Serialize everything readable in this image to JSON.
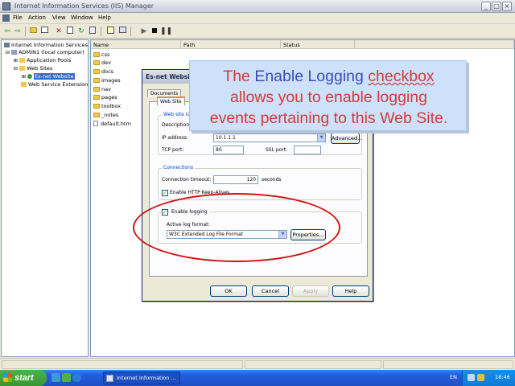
{
  "window": {
    "title": "Internet Information Services (IIS) Manager",
    "controls": {
      "minimize": "_",
      "maximize": "□",
      "close": "×"
    }
  },
  "menu": {
    "items": [
      "File",
      "Action",
      "View",
      "Window",
      "Help"
    ]
  },
  "toolbar": {
    "icons": [
      "back-arrow-icon",
      "forward-arrow-icon",
      "up-folder-icon",
      "show-tree-icon",
      "delete-icon",
      "properties-icon",
      "refresh-icon",
      "export-icon",
      "help-icon",
      "console-icon",
      "play-icon",
      "stop-icon",
      "pause-icon"
    ]
  },
  "tree": {
    "root": "Internet Information Services",
    "computer": "ADMIN1 (local computer)",
    "app_pools": "Application Pools",
    "web_sites": "Web Sites",
    "selected_site": "Es-net Website",
    "web_service_ext": "Web Service Extension"
  },
  "list": {
    "columns": [
      "Name",
      "Path",
      "Status"
    ],
    "folders": [
      "css",
      "dev",
      "docs",
      "images",
      "nav",
      "pages",
      "toolbox",
      "_notes"
    ],
    "files": [
      "default.htm"
    ]
  },
  "dialog": {
    "title": "Es-net Website Properties",
    "tabs": {
      "documents": "Documents",
      "web_site": "Web Site"
    },
    "identification": {
      "legend": "Web site identification",
      "description_label": "Description:",
      "ip_label": "IP address:",
      "ip_value": "10.1.1.1",
      "advanced_button": "Advanced...",
      "tcp_label": "TCP port:",
      "tcp_value": "80",
      "ssl_label": "SSL port:",
      "ssl_value": ""
    },
    "connections": {
      "legend": "Connections",
      "timeout_label": "Connection timeout:",
      "timeout_value": "120",
      "timeout_unit": "seconds",
      "keepalive_label": "Enable HTTP Keep-Alives",
      "keepalive_checked": true
    },
    "logging": {
      "enable_label": "Enable logging",
      "enable_checked": true,
      "format_label": "Active log format:",
      "format_value": "W3C Extended Log File Format",
      "properties_button": "Properties..."
    },
    "buttons": {
      "ok": "OK",
      "cancel": "Cancel",
      "apply": "Apply",
      "help": "Help"
    }
  },
  "callout": {
    "line1_prefix": "The",
    "line1_highlight": "Enable Logging",
    "line1_underlined": "checkbox",
    "line2": "allows you to enable logging",
    "line3": "events pertaining to this Web Site."
  },
  "taskbar": {
    "start_label": "start",
    "task_label": "Internet Information ...",
    "language": "EN",
    "clock": "18:46"
  }
}
